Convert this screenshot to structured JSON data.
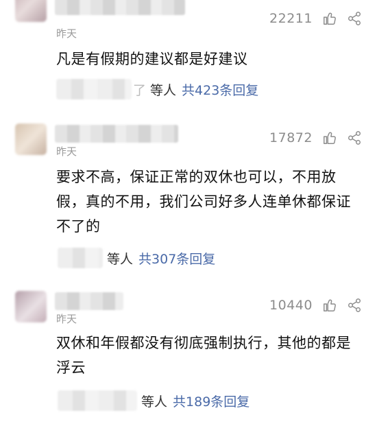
{
  "comments": [
    {
      "time": "昨天",
      "likes": "22211",
      "text": "凡是有假期的建议都是好建议",
      "reply_suffix": "等人",
      "reply_link": "共423条回复",
      "reply_partial": "了"
    },
    {
      "time": "昨天",
      "likes": "17872",
      "text": "要求不高，保证正常的双休也可以，不用放假，真的不用，我们公司好多人连单休都保证不了的",
      "reply_suffix": "等人",
      "reply_link": "共307条回复"
    },
    {
      "time": "昨天",
      "likes": "10440",
      "text": "双休和年假都没有彻底强制执行，其他的都是浮云",
      "reply_suffix": "等人",
      "reply_link": "共189条回复"
    }
  ],
  "icons": {
    "like": "thumbs-up-icon",
    "share": "share-icon"
  },
  "colors": {
    "link": "#4a6aa8",
    "muted": "#8c8c8c"
  }
}
